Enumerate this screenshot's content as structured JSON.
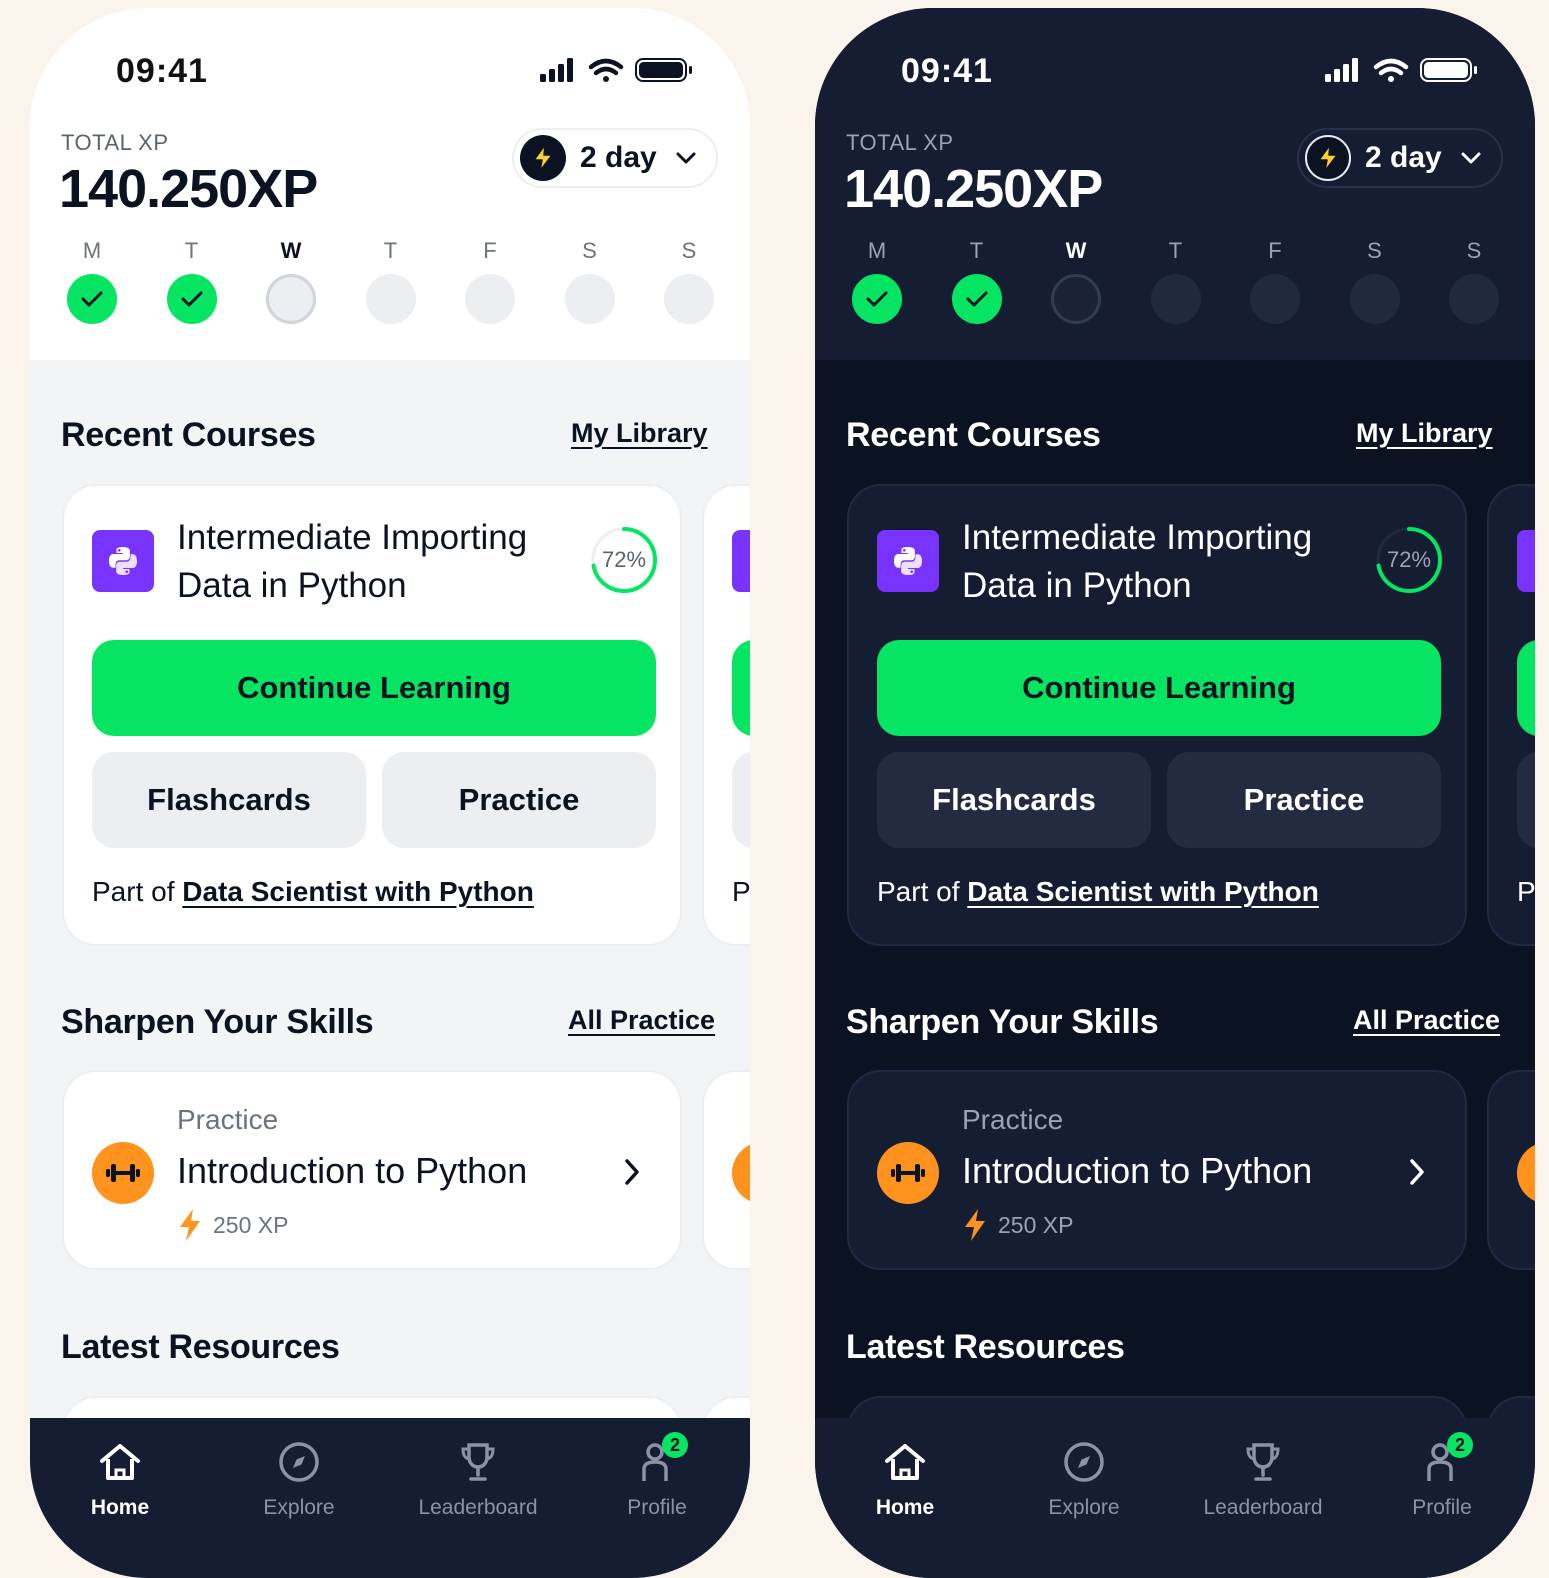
{
  "status": {
    "time": "09:41"
  },
  "xp": {
    "label": "TOTAL XP",
    "value": "140.250XP"
  },
  "streak": {
    "label": "2 day"
  },
  "week": {
    "days": [
      {
        "letter": "M",
        "state": "done"
      },
      {
        "letter": "T",
        "state": "done"
      },
      {
        "letter": "W",
        "state": "current"
      },
      {
        "letter": "T",
        "state": "empty"
      },
      {
        "letter": "F",
        "state": "empty"
      },
      {
        "letter": "S",
        "state": "empty"
      },
      {
        "letter": "S",
        "state": "empty"
      }
    ]
  },
  "recent": {
    "title": "Recent Courses",
    "link": "My Library",
    "course": {
      "title_line1": "Intermediate Importing",
      "title_line2": "Data in Python",
      "progress": "72%",
      "progress_fraction": 0.72,
      "continue_label": "Continue Learning",
      "flashcards_label": "Flashcards",
      "practice_label": "Practice",
      "part_of_prefix": "Part of",
      "track": "Data Scientist with Python",
      "peek_letter": "P"
    }
  },
  "skills": {
    "title": "Sharpen Your Skills",
    "link": "All Practice",
    "item": {
      "label": "Practice",
      "title": "Introduction to Python",
      "xp": "250 XP"
    }
  },
  "resources": {
    "title": "Latest Resources"
  },
  "nav": {
    "items": [
      {
        "label": "Home",
        "icon": "home-icon",
        "active": true
      },
      {
        "label": "Explore",
        "icon": "compass-icon",
        "active": false
      },
      {
        "label": "Leaderboard",
        "icon": "trophy-icon",
        "active": false
      },
      {
        "label": "Profile",
        "icon": "profile-icon",
        "active": false
      }
    ],
    "profile_badge": "2"
  },
  "colors": {
    "accent_green": "#05e562",
    "python_purple": "#7933ff",
    "practice_orange": "#ff931e",
    "dark_bg": "#0b1322",
    "dark_surface": "#141d32"
  }
}
